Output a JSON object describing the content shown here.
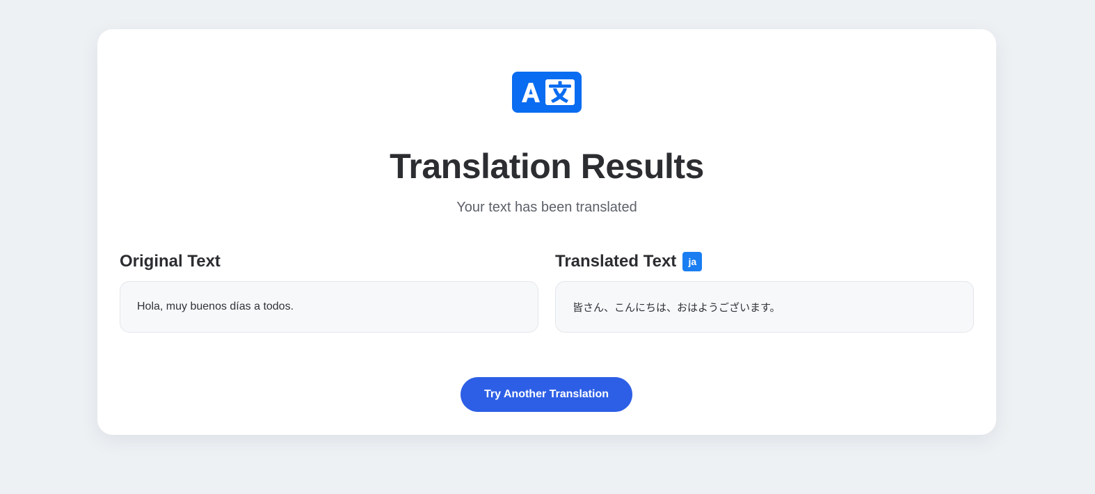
{
  "logo": {
    "icon": "translate-icon",
    "color": "#0a6cf0"
  },
  "header": {
    "title": "Translation Results",
    "subtitle": "Your text has been translated"
  },
  "original": {
    "heading": "Original Text",
    "text": "Hola, muy buenos días a todos."
  },
  "translated": {
    "heading": "Translated Text",
    "language_code": "ja",
    "text": "皆さん、こんにちは、おはようございます。"
  },
  "actions": {
    "try_another_label": "Try Another Translation",
    "button_color": "#2d5fe6"
  }
}
